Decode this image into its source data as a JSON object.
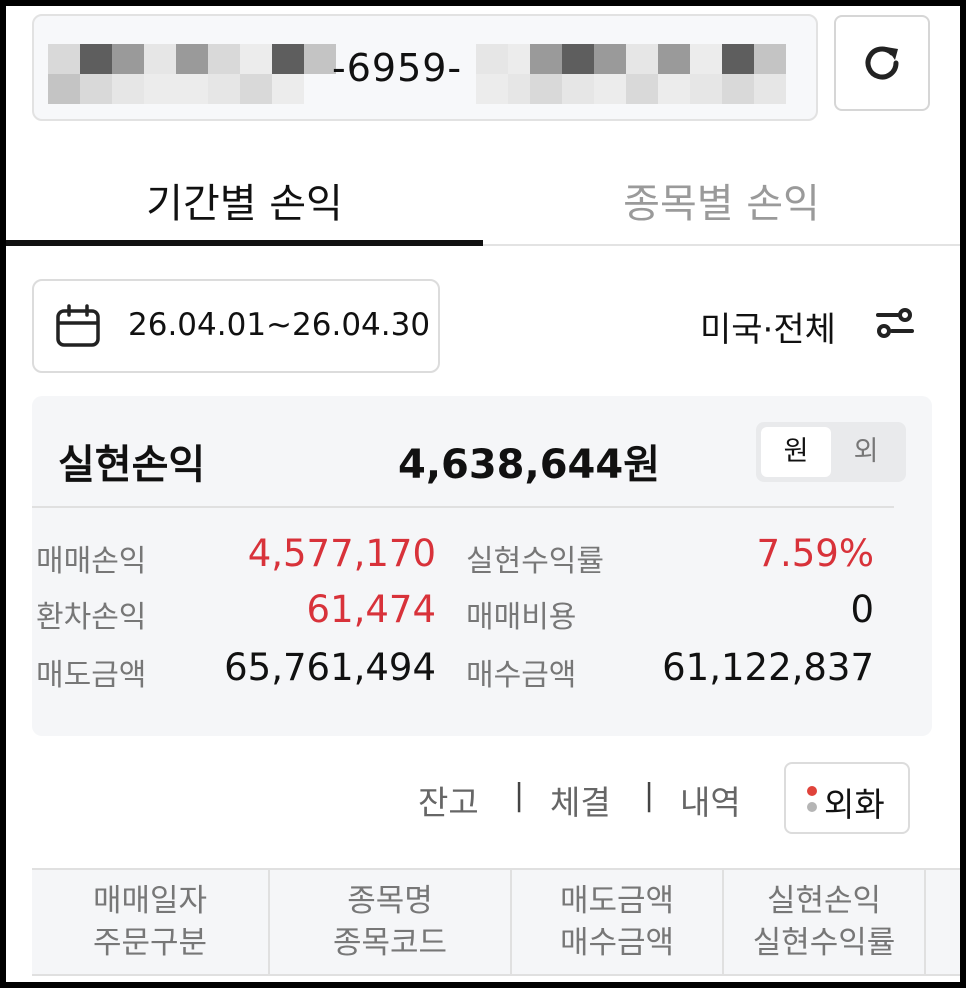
{
  "account": {
    "visible_number": "-6959-"
  },
  "tabs": [
    {
      "label": "기간별 손익"
    },
    {
      "label": "종목별 손익"
    }
  ],
  "filter": {
    "date_range": "26.04.01~26.04.30",
    "region": "미국·전체"
  },
  "summary": {
    "title": "실현손익",
    "value": "4,638,644원",
    "currency_options": [
      "원",
      "외"
    ],
    "selected_currency": "원",
    "rows": [
      {
        "label": "매매손익",
        "value": "4,577,170",
        "label2": "실현수익률",
        "value2": "7.59%"
      },
      {
        "label": "환차손익",
        "value": "61,474",
        "label2": "매매비용",
        "value2": "0"
      },
      {
        "label": "매도금액",
        "value": "65,761,494",
        "label2": "매수금액",
        "value2": "61,122,837"
      }
    ]
  },
  "links": {
    "balance": "잔고",
    "executions": "체결",
    "history": "내역",
    "separator": "|",
    "fx_button": "외화"
  },
  "table_header": [
    {
      "line1": "매매일자",
      "line2": "주문구분"
    },
    {
      "line1": "종목명",
      "line2": "종목코드"
    },
    {
      "line1": "매도금액",
      "line2": "매수금액"
    },
    {
      "line1": "실현손익",
      "line2": "실현수익률"
    }
  ],
  "colors": {
    "positive": "#d8323a",
    "active_tab": "#111111",
    "inactive_tab": "#9a9a9a"
  },
  "icons": {
    "refresh": "refresh-icon",
    "calendar": "calendar-icon",
    "filter": "filter-sliders-icon"
  }
}
